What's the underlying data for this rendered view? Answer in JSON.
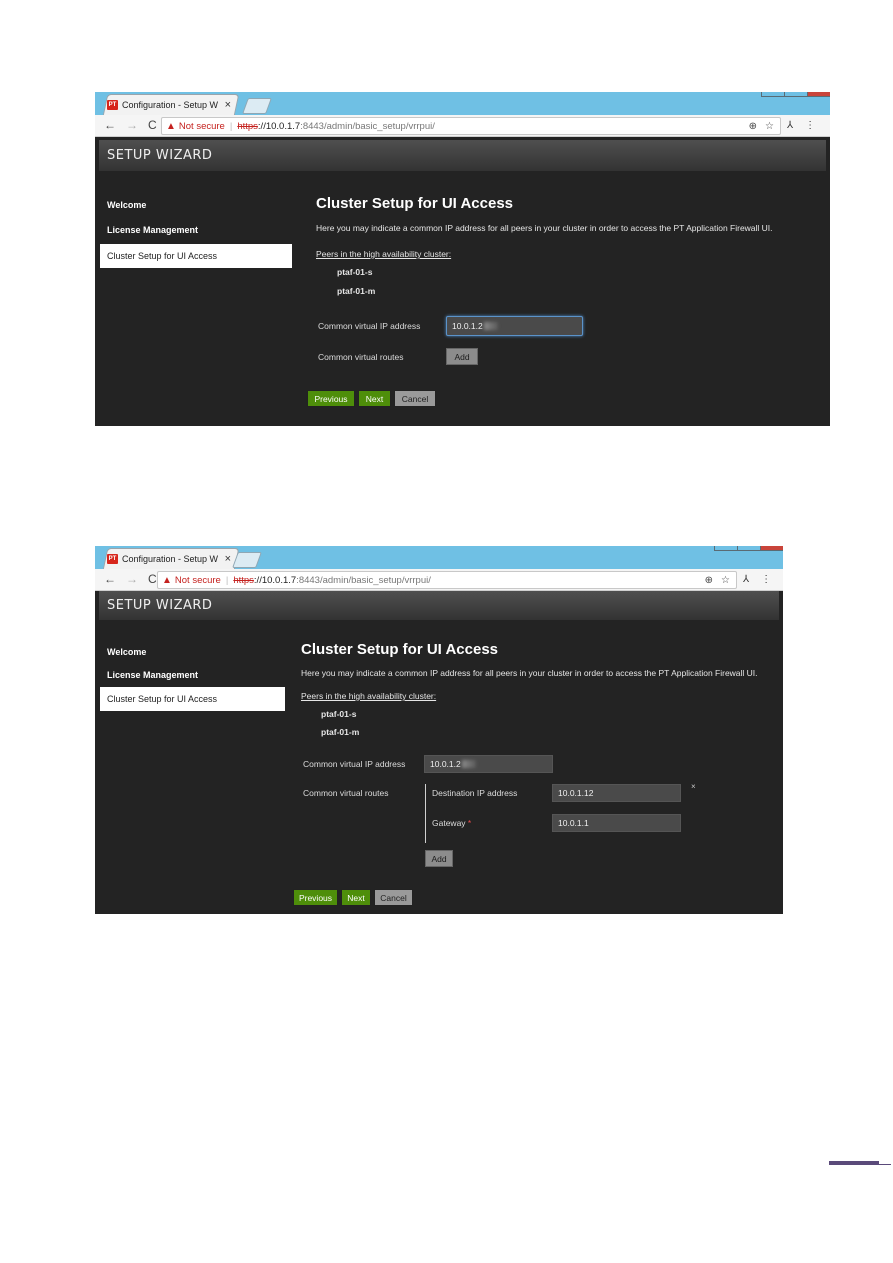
{
  "screens": [
    {
      "tab_title": "Configuration - Setup W",
      "favicon": "PT",
      "url_warning": "Not secure",
      "url_scheme": "https",
      "url_host": "://10.0.1.7",
      "url_path": ":8443/admin/basic_setup/vrrpui/",
      "header_title": "SETUP WIZARD",
      "sidebar": [
        "Welcome",
        "License Management",
        "Cluster Setup for UI Access"
      ],
      "title": "Cluster Setup for UI Access",
      "description": "Here you may indicate a common IP address for all peers in your cluster in order to access the PT Application Firewall UI.",
      "peers_label": "Peers in the high availability cluster:",
      "peers": [
        "ptaf-01-s",
        "ptaf-01-m"
      ],
      "vip_label": "Common virtual IP address",
      "vip_value": "10.0.1.2",
      "routes_label": "Common virtual routes",
      "add_label": "Add",
      "buttons": {
        "previous": "Previous",
        "next": "Next",
        "cancel": "Cancel"
      }
    },
    {
      "tab_title": "Configuration - Setup W",
      "favicon": "PT",
      "url_warning": "Not secure",
      "url_scheme": "https",
      "url_host": "://10.0.1.7",
      "url_path": ":8443/admin/basic_setup/vrrpui/",
      "header_title": "SETUP WIZARD",
      "sidebar": [
        "Welcome",
        "License Management",
        "Cluster Setup for UI Access"
      ],
      "title": "Cluster Setup for UI Access",
      "description": "Here you may indicate a common IP address for all peers in your cluster in order to access the PT Application Firewall UI.",
      "peers_label": "Peers in the high availability cluster:",
      "peers": [
        "ptaf-01-s",
        "ptaf-01-m"
      ],
      "vip_label": "Common virtual IP address",
      "vip_value": "10.0.1.2",
      "routes_label": "Common virtual routes",
      "dest_label": "Destination IP address",
      "dest_value": "10.0.1.12",
      "gateway_label": "Gateway",
      "gateway_required": "*",
      "gateway_value": "10.0.1.1",
      "remove_route": "×",
      "add_label": "Add",
      "buttons": {
        "previous": "Previous",
        "next": "Next",
        "cancel": "Cancel"
      }
    }
  ],
  "icons": {
    "close": "×",
    "back": "←",
    "forward": "→",
    "reload": "C",
    "warning": "▲",
    "zoom": "⊕",
    "star": "☆",
    "extension": "⅄",
    "menu": "⋮"
  },
  "colors": {
    "accent_green": "#4e8e0a",
    "background_dark": "#232323",
    "titlebar": "#6fc0e4",
    "warning_red": "#c5221f"
  }
}
